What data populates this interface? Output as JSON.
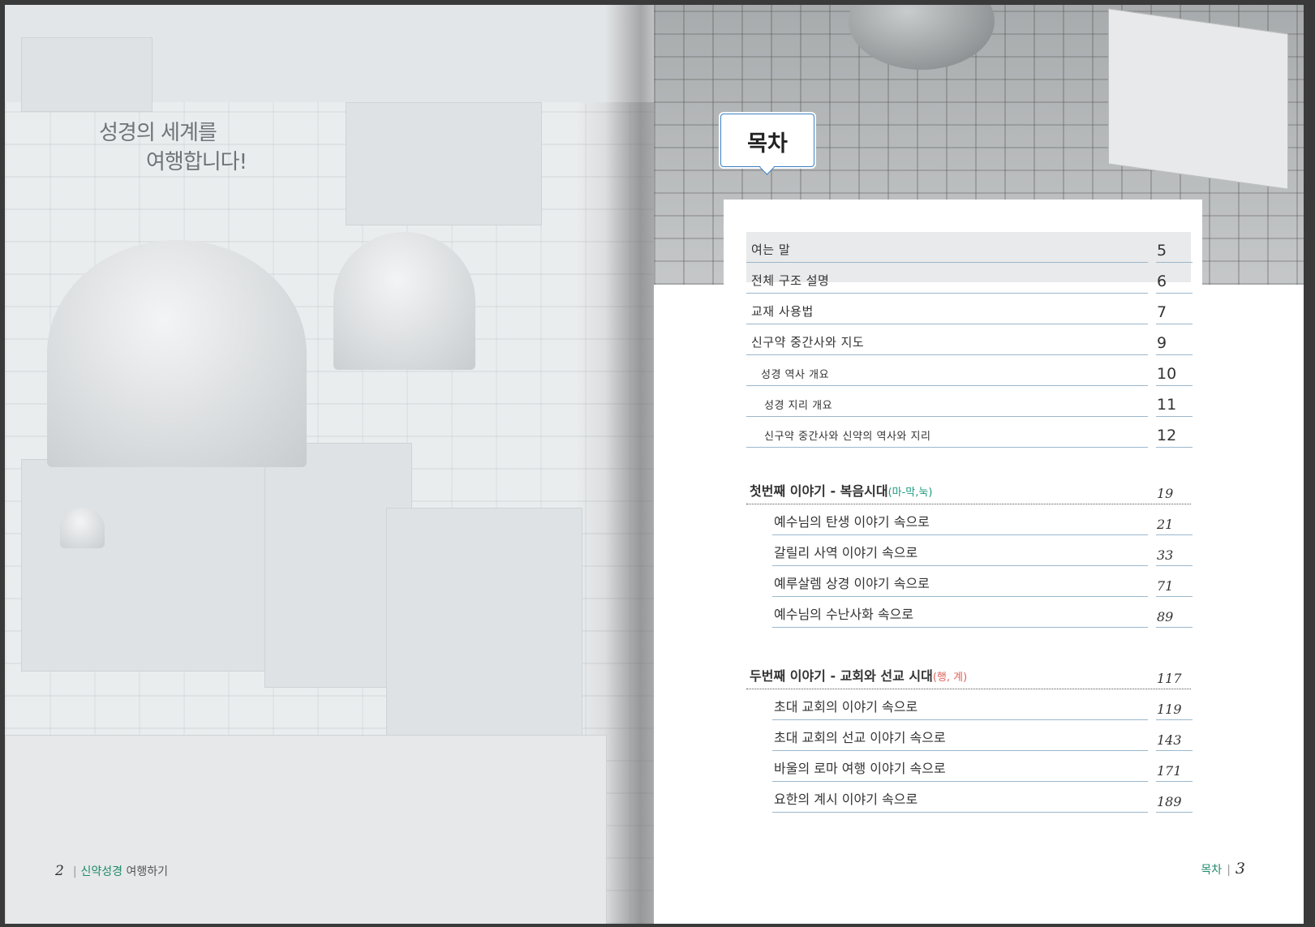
{
  "left_page": {
    "tagline_line1": "성경의 세계를",
    "tagline_line2": "여행합니다!",
    "folio_number": "2",
    "folio_title_green": "신약성경",
    "folio_title_gray": "여행하기"
  },
  "right_page": {
    "badge": "목차",
    "toc": [
      {
        "label": "여는 말",
        "page": "5",
        "level": "top"
      },
      {
        "label": "전체 구조 설명",
        "page": "6",
        "level": "top"
      },
      {
        "label": "교재 사용법",
        "page": "7",
        "level": "top"
      },
      {
        "label": "신구약 중간사와 지도",
        "page": "9",
        "level": "top"
      },
      {
        "label": "성경 역사 개요",
        "page": "10",
        "level": "sub"
      },
      {
        "label": "성경 지리 개요",
        "page": "11",
        "level": "sub"
      },
      {
        "label": "신구약 중간사와 신약의 역사와 지리",
        "page": "12",
        "level": "sub"
      }
    ],
    "part1": {
      "heading": "첫번째 이야기 - 복음시대",
      "tag": "(마-막,눅)",
      "page": "19",
      "items": [
        {
          "label": "예수님의 탄생 이야기 속으로",
          "page": "21"
        },
        {
          "label": "갈릴리 사역 이야기 속으로",
          "page": "33"
        },
        {
          "label": "예루살렘 상경 이야기 속으로",
          "page": "71"
        },
        {
          "label": "예수님의 수난사화 속으로",
          "page": "89"
        }
      ]
    },
    "part2": {
      "heading": "두번째 이야기 - 교회와 선교 시대",
      "tag": "(행, 계)",
      "page": "117",
      "items": [
        {
          "label": "초대 교회의 이야기 속으로",
          "page": "119"
        },
        {
          "label": "초대 교회의 선교 이야기 속으로",
          "page": "143"
        },
        {
          "label": "바울의 로마 여행 이야기 속으로",
          "page": "171"
        },
        {
          "label": "요한의 계시 이야기 속으로",
          "page": "189"
        }
      ]
    },
    "folio_title": "목차",
    "folio_number": "3"
  },
  "colors": {
    "accent_green": "#1f8a6b",
    "accent_red": "#e0645a",
    "badge_border": "#3b7fc4",
    "rule": "#9bb7cc"
  }
}
